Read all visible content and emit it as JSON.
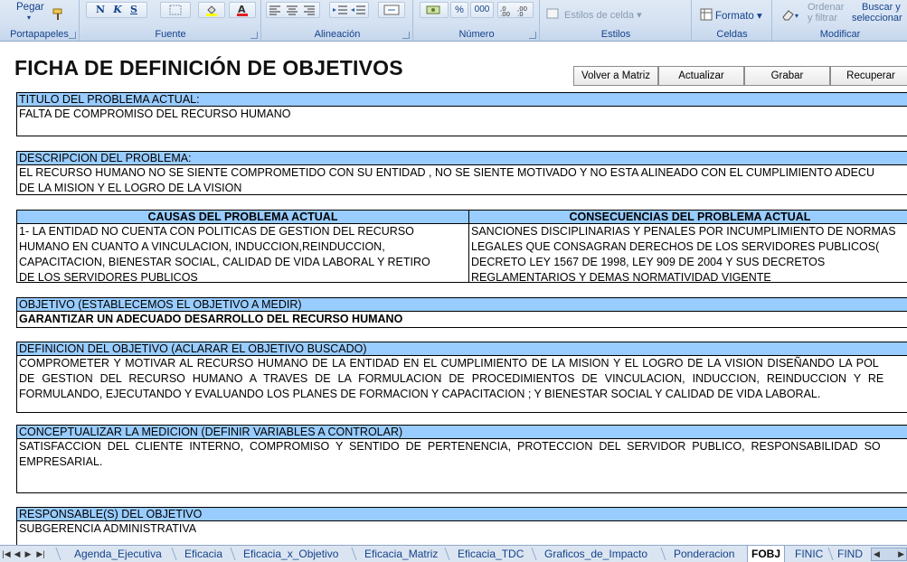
{
  "ribbon": {
    "groups": {
      "portapapeles": "Portapapeles",
      "fuente": "Fuente",
      "alineacion": "Alineación",
      "numero": "Número",
      "estilos": "Estilos",
      "celdas": "Celdas",
      "modificar": "Modificar"
    },
    "paste_label": "Pegar",
    "bold_btn": "N",
    "italic_btn": "K",
    "underline_btn": "S",
    "percent_btn": "%",
    "thousands_btn": "000",
    "cell_styles_label": "Estilos de celda",
    "format_label": "Formato",
    "sort_label_1": "Ordenar",
    "sort_label_2": "y filtrar",
    "find_label_1": "Buscar y",
    "find_label_2": "seleccionar"
  },
  "page": {
    "title": "FICHA DE DEFINICIÓN DE OBJETIVOS",
    "buttons": {
      "back": "Volver a Matriz",
      "update": "Actualizar",
      "save": "Grabar",
      "recover": "Recuperar"
    }
  },
  "sections": {
    "titulo": {
      "header": "TITULO DEL PROBLEMA ACTUAL:",
      "value": "FALTA DE COMPROMISO DEL RECURSO HUMANO"
    },
    "descripcion": {
      "header": "DESCRIPCION DEL PROBLEMA:",
      "line1": "EL RECURSO HUMANO NO SE SIENTE COMPROMETIDO CON SU ENTIDAD , NO SE SIENTE MOTIVADO Y NO ESTA ALINEADO CON EL CUMPLIMIENTO ADECU",
      "line2": "DE LA MISION Y EL LOGRO DE LA VISION"
    },
    "causas": {
      "header": "CAUSAS DEL PROBLEMA ACTUAL",
      "line1": "1- LA ENTIDAD NO CUENTA CON POLITICAS DE GESTION DEL RECURSO",
      "line2": "HUMANO EN CUANTO A VINCULACION, INDUCCION,REINDUCCION,",
      "line3": "CAPACITACION, BIENESTAR SOCIAL, CALIDAD DE VIDA LABORAL Y RETIRO",
      "line4": "DE LOS SERVIDORES PUBLICOS"
    },
    "consecuencias": {
      "header": "CONSECUENCIAS DEL PROBLEMA ACTUAL",
      "line1": "SANCIONES DISCIPLINARIAS Y PENALES POR INCUMPLIMIENTO DE NORMAS",
      "line2": "LEGALES QUE CONSAGRAN DERECHOS DE LOS SERVIDORES PUBLICOS(",
      "line3": "DECRETO LEY 1567 DE 1998, LEY 909 DE 2004 Y SUS DECRETOS",
      "line4": "REGLAMENTARIOS Y DEMAS NORMATIVIDAD VIGENTE"
    },
    "objetivo": {
      "header": "OBJETIVO (ESTABLECEMOS EL OBJETIVO A MEDIR)",
      "value": "GARANTIZAR UN ADECUADO DESARROLLO DEL RECURSO HUMANO"
    },
    "definicion": {
      "header": "DEFINICION DEL OBJETIVO (ACLARAR EL OBJETIVO BUSCADO)",
      "line1": "COMPROMETER Y MOTIVAR AL RECURSO HUMANO DE LA ENTIDAD EN EL CUMPLIMIENTO DE LA  MISION Y EL LOGRO DE LA VISION DISEÑANDO LA POL",
      "line2": "DE GESTION DEL RECURSO HUMANO A TRAVES DE LA FORMULACION DE PROCEDIMIENTOS DE VINCULACION, INDUCCION, REINDUCCION Y RE",
      "line3": "FORMULANDO, EJECUTANDO Y EVALUANDO LOS PLANES DE FORMACION Y CAPACITACION ; Y BIENESTAR SOCIAL Y CALIDAD DE VIDA LABORAL."
    },
    "conceptualizar": {
      "header": "CONCEPTUALIZAR LA MEDICION (DEFINIR VARIABLES A CONTROLAR)",
      "line1": "SATISFACCION DEL CLIENTE INTERNO, COMPROMISO Y SENTIDO DE PERTENENCIA, PROTECCION DEL SERVIDOR PUBLICO, RESPONSABILIDAD SO",
      "line2": "EMPRESARIAL."
    },
    "responsable": {
      "header": "RESPONSABLE(S) DEL OBJETIVO",
      "value": "SUBGERENCIA ADMINISTRATIVA"
    }
  },
  "sheet_tabs": [
    "Agenda_Ejecutiva",
    "Eficacia",
    "Eficacia_x_Objetivo",
    "Eficacia_Matriz",
    "Eficacia_TDC",
    "Graficos_de_Impacto",
    "Ponderacion",
    "FOBJ",
    "FINIC",
    "FIND"
  ],
  "active_tab": "FOBJ",
  "colors": {
    "section_header_bg": "#99ccff",
    "ribbon_label": "#15428b"
  }
}
